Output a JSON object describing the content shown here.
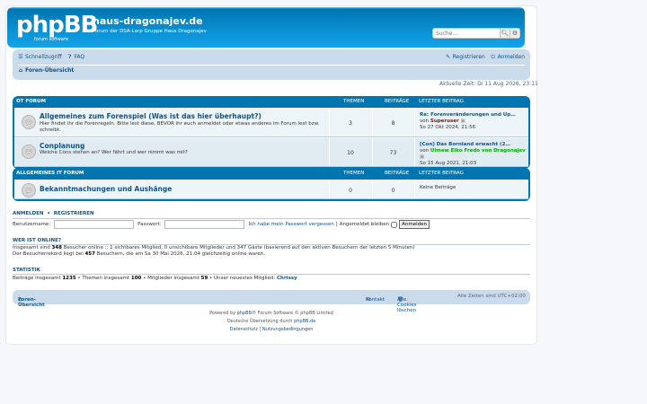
{
  "header": {
    "logo_text": "phpBB",
    "logo_sub": "forum software",
    "site_title": "haus-dragonajev.de",
    "site_desc": "Forum der DSA-Larp Gruppe Haus Dragonajev",
    "search_placeholder": "Suche…"
  },
  "nav": {
    "quick_links": "Schnellzugriff",
    "faq": "FAQ",
    "register": "Registrieren",
    "login": "Anmelden",
    "breadcrumb": "Foren-Übersicht"
  },
  "current_time": "Aktuelle Zeit: Di 11 Aug 2026, 23:11",
  "categories": [
    {
      "name": "OT FORUM",
      "col_topics": "THEMEN",
      "col_posts": "BEITRÄGE",
      "col_last": "LETZTER BEITRAG",
      "forums": [
        {
          "title": "Allgemeines zum Forenspiel (Was ist das hier überhaupt?)",
          "desc": "Hier findet ihr die Forenregeln. Bitte lest diese, BEVOR ihr euch anmeldet oder etwas anderes im Forum lest bzw. schreibt.",
          "topics": "3",
          "posts": "8",
          "last_title": "Re: Forenveränderungen und Up…",
          "last_by": "von",
          "last_user": "Superuser",
          "last_user_color": "#AA0000",
          "last_date": "So 27 Okt 2024, 21:56"
        },
        {
          "title": "Conplanung",
          "desc": "Welche Cons stehen an? Wer fährt und wer nimmt was mit?",
          "topics": "10",
          "posts": "73",
          "last_title": "[Con] Das Bornland erwacht (2…",
          "last_by": "von",
          "last_user": "Ulmew Elko Fredo von Dragonajev",
          "last_user_color": "#00AA00",
          "last_date": "So 15 Aug 2021, 21:03"
        }
      ]
    },
    {
      "name": "ALLGEMEINES IT FORUM",
      "col_topics": "THEMEN",
      "col_posts": "BEITRÄGE",
      "col_last": "LETZTER BEITRAG",
      "forums": [
        {
          "title": "Bekanntmachungen und Aushänge",
          "desc": "",
          "topics": "0",
          "posts": "0",
          "last_title": "Keine Beiträge"
        }
      ]
    }
  ],
  "login_section": {
    "title_login": "ANMELDEN",
    "title_register": "REGISTRIEREN",
    "username_label": "Benutzername:",
    "password_label": "Passwort:",
    "forgot": "Ich habe mein Passwort vergessen",
    "remember": "Angemeldet bleiben",
    "submit": "Anmelden"
  },
  "online": {
    "title": "WER IST ONLINE?",
    "line1_pre": "Insgesamt sind",
    "line1_count": "348",
    "line1_post": "Besucher online :: 1 sichtbares Mitglied, 0 unsichtbare Mitglieder und 347 Gäste (basierend auf den aktiven Besuchern der letzten 5 Minuten)",
    "line2_pre": "Der Besucherrekord liegt bei",
    "line2_count": "457",
    "line2_post": "Besuchern, die am Sa 30 Mai 2026, 21:04 gleichzeitig online waren."
  },
  "stats": {
    "title": "STATISTIK",
    "posts_label": "Beiträge insgesamt",
    "posts": "1235",
    "topics_label": "Themen insgesamt",
    "topics": "100",
    "members_label": "Mitglieder insgesamt",
    "members": "59",
    "newest_label": "Unser neuestes Mitglied:",
    "newest": "Chrissy"
  },
  "footer": {
    "breadcrumb": "Foren-Übersicht",
    "contact": "Kontakt",
    "cookies": "Alle Cookies löschen",
    "timezone": "Alle Zeiten sind UTC+02:00",
    "powered_pre": "Powered by",
    "powered_link": "phpBB",
    "powered_post": "® Forum Software © phpBB Limited",
    "translation_pre": "Deutsche Übersetzung durch",
    "translation_link": "phpBB.de",
    "privacy": "Datenschutz",
    "terms": "Nutzungsbedingungen"
  }
}
